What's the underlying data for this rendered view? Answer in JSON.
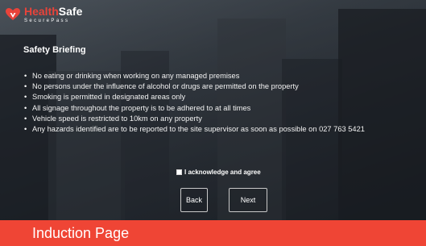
{
  "logo": {
    "brand_part1": "Health",
    "brand_part2": "Safe",
    "tagline": "SecurePass"
  },
  "briefing": {
    "title": "Safety Briefing",
    "rules": [
      "No eating or drinking when working on any managed premises",
      "No persons under the influence of alcohol or drugs are permitted on the property",
      "Smoking is permitted in designated areas only",
      "All signage throughout the property is to be adhered to at all times",
      "Vehicle speed is restricted to 10km on any property",
      "Any hazards identified are to be reported to the site supervisor as soon as possible on 027 763 5421"
    ]
  },
  "acknowledge": {
    "label": "I acknowledge and agree",
    "checked": false
  },
  "buttons": {
    "back": "Back",
    "next": "Next"
  },
  "banner": {
    "text": "Induction Page"
  },
  "colors": {
    "brand_red": "#ef4535",
    "text_white": "#ffffff"
  }
}
